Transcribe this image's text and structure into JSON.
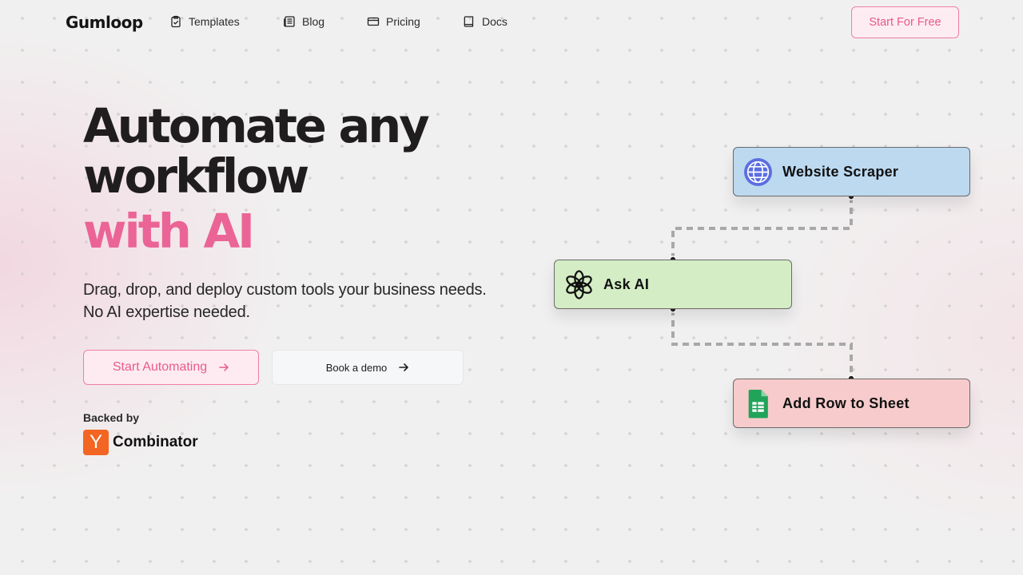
{
  "nav": {
    "logo": "Gumloop",
    "links": [
      {
        "label": "Templates",
        "icon": "clipboard-check-icon"
      },
      {
        "label": "Blog",
        "icon": "newspaper-icon"
      },
      {
        "label": "Pricing",
        "icon": "credit-card-icon"
      },
      {
        "label": "Docs",
        "icon": "book-icon"
      }
    ],
    "cta": "Start For Free"
  },
  "hero": {
    "title_line1": "Automate any",
    "title_line2": "workflow",
    "title_accent": "with AI",
    "subtitle_line1": "Drag, drop, and deploy custom tools your business needs.",
    "subtitle_line2": "No AI expertise needed.",
    "primary_button": "Start Automating",
    "secondary_button": "Book a demo",
    "backed_by": "Backed by",
    "backer_mark": "Y",
    "backer_name": "Combinator"
  },
  "workflow": {
    "nodes": [
      {
        "label": "Website Scraper",
        "icon": "globe-icon",
        "color": "#bcd9f0"
      },
      {
        "label": "Ask AI",
        "icon": "openai-icon",
        "color": "#d4edc4"
      },
      {
        "label": "Add Row to Sheet",
        "icon": "google-sheets-icon",
        "color": "#f7cbcb"
      }
    ]
  },
  "colors": {
    "accent": "#eb6496",
    "yc_orange": "#f26522"
  }
}
